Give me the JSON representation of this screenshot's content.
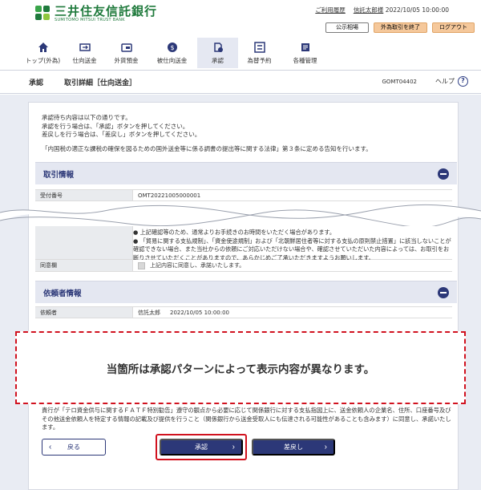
{
  "header": {
    "bank_name": "三井住友信託銀行",
    "bank_name_en": "SUMITOMO MITSUI TRUST BANK",
    "usage_link": "ご利用履歴",
    "user_name": "信託太郎様",
    "datetime": "2022/10/05 10:00:00",
    "public_key_button": "公示相場",
    "fx_end_button": "外為取引を終了",
    "logout_button": "ログアウト"
  },
  "nav": {
    "items": [
      {
        "label": "トップ(外為)",
        "icon": "home-icon"
      },
      {
        "label": "仕向送金",
        "icon": "remittance-icon"
      },
      {
        "label": "外貨預金",
        "icon": "deposit-icon"
      },
      {
        "label": "被仕向送金",
        "icon": "incoming-remittance-icon"
      },
      {
        "label": "承認",
        "icon": "approval-icon",
        "active": true
      },
      {
        "label": "為替予約",
        "icon": "fx-contract-icon"
      },
      {
        "label": "各種管理",
        "icon": "management-icon"
      }
    ]
  },
  "titlebar": {
    "category": "承認",
    "title": "取引詳細［仕向送金］",
    "screen_id": "GOMT04402",
    "help": "ヘルプ"
  },
  "message": {
    "line1": "承認待ち内容は以下の通りです。",
    "line2": "承認を行う場合は、「承認」ボタンを押してください。",
    "line3": "差戻しを行う場合は、「差戻し」ボタンを押してください。",
    "note": "「内国税の適正な課税の確保を図るための国外送金等に係る調書の提出等に関する法律」第３条に定める告知を行います。"
  },
  "transaction": {
    "section_title": "取引情報",
    "reference_label": "受付番号",
    "reference_value": "OMT20221005000001",
    "bullets": [
      "上記確認等のため、通常よりお手続きのお時間をいただく場合があります。",
      "「貿易に関する支払規制」、「資金使途規制」および「北朝鮮居住者等に対する支払の原則禁止措置」に該当しないことが確認できない場合、また当社からの依頼にご対応いただけない場合や、確認させていただいた内容によっては、お取引をお断りさせていただくことがありますので、あらかじめご了承いただきますようお願いします。"
    ],
    "consent_label": "同意欄",
    "consent_text": "上記内容に同意し、承諾いたします。"
  },
  "requester": {
    "section_title": "依頼者情報",
    "label": "依頼者",
    "name": "信託太郎",
    "datetime": "2022/10/05 10:00:00"
  },
  "overlay_text": "当箇所は承認パターンによって表示内容が異なります。",
  "notice": "貴行が「テロ資金供与に関するＦＡＴＦ特別勧告」遵守の観点から必要に応じて関係銀行に対する支払指図上に、送金依頼人の企業名、住所、口座番号及びその他送金依頼人を特定する情報の記載及び提供を行うこと（関係銀行から送金受取人にも伝達される可能性があることも含みます）に同意し、承諾いたします。",
  "buttons": {
    "back": "戻る",
    "approve": "承認",
    "reject": "差戻し"
  },
  "colors": {
    "brand_green": "#1f7a3c",
    "navy": "#2c3878",
    "highlight_red": "#d1121f"
  }
}
